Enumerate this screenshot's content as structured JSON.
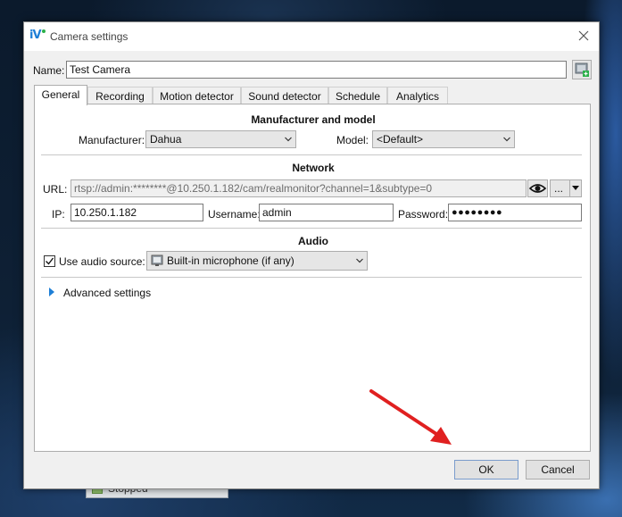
{
  "window": {
    "title": "Camera settings",
    "close": "×"
  },
  "name": {
    "label": "Name:",
    "value": "Test Camera"
  },
  "tabs": [
    {
      "label": "General",
      "active": true
    },
    {
      "label": "Recording"
    },
    {
      "label": "Motion detector"
    },
    {
      "label": "Sound detector"
    },
    {
      "label": "Schedule"
    },
    {
      "label": "Analytics"
    }
  ],
  "manufacturer_section": {
    "title": "Manufacturer and model",
    "manufacturer_label": "Manufacturer:",
    "manufacturer_value": "Dahua",
    "model_label": "Model:",
    "model_value": "<Default>"
  },
  "network": {
    "title": "Network",
    "url_label": "URL:",
    "url_value": "rtsp://admin:********@10.250.1.182/cam/realmonitor?channel=1&subtype=0",
    "more_label": "...",
    "ip_label": "IP:",
    "ip_value": "10.250.1.182",
    "username_label": "Username:",
    "username_value": "admin",
    "password_label": "Password:",
    "password_value": "●●●●●●●●"
  },
  "audio": {
    "title": "Audio",
    "use_label": "Use audio source:",
    "checked": true,
    "source_value": "Built-in microphone (if any)"
  },
  "advanced": {
    "label": "Advanced settings"
  },
  "buttons": {
    "ok": "OK",
    "cancel": "Cancel"
  },
  "background_status": {
    "label": "Stopped"
  },
  "colors": {
    "accent": "#1e7fd6",
    "annotation_arrow": "#e02020"
  }
}
